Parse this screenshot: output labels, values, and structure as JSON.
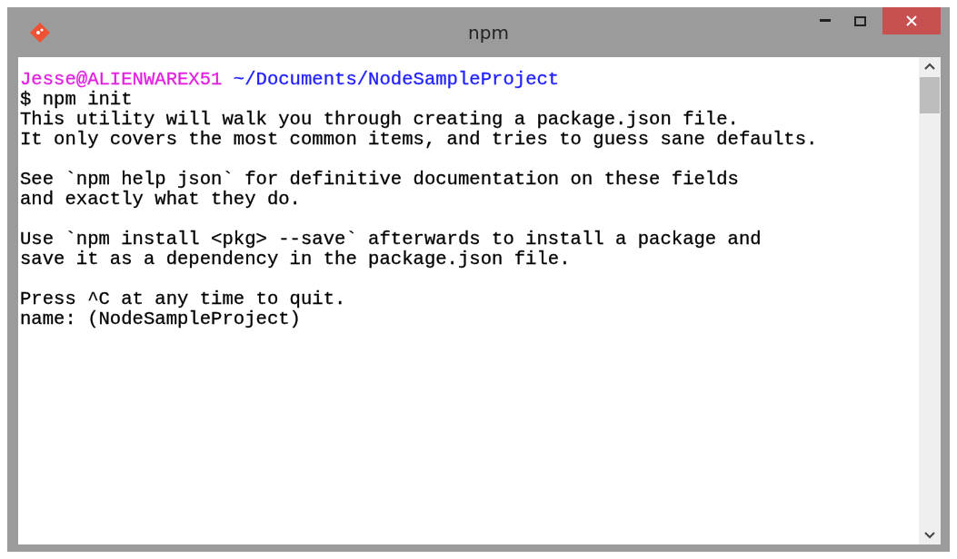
{
  "window": {
    "title": "npm"
  },
  "prompt": {
    "user": "Jesse@ALIENWAREX51",
    "path": "~/Documents/NodeSampleProject"
  },
  "output_blocks": [
    [
      "$ npm init",
      "This utility will walk you through creating a package.json file.",
      "It only covers the most common items, and tries to guess sane defaults."
    ],
    [
      "See `npm help json` for definitive documentation on these fields",
      "and exactly what they do."
    ],
    [
      "Use `npm install <pkg> --save` afterwards to install a package and",
      "save it as a dependency in the package.json file."
    ],
    [
      "Press ^C at any time to quit.",
      "name: (NodeSampleProject)"
    ]
  ]
}
